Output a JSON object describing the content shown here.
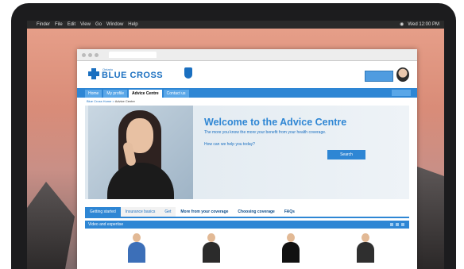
{
  "mac_menu": {
    "items": [
      "Finder",
      "File",
      "Edit",
      "View",
      "Go",
      "Window",
      "Help"
    ],
    "clock": "Wed 12:00 PM"
  },
  "site": {
    "logo_small": "Ontario",
    "logo_text": "BLUE CROSS",
    "nav": [
      "Home",
      "My profile",
      "Advice Centre",
      "Contact us"
    ]
  },
  "breadcrumb": {
    "parent": "Blue Cross Home",
    "current": "Advice Centre"
  },
  "hero": {
    "title": "Welcome to the Advice Centre",
    "subtext": "The more you know the more your benefit from your health coverage.",
    "question": "How can we help you today?",
    "search_button": "Search"
  },
  "content_tabs": [
    "Getting started",
    "Insurance basics",
    "Get",
    "More from your coverage",
    "Choosing coverage",
    "FAQs"
  ],
  "panel": {
    "title": "Video and expertise"
  },
  "people": [
    {
      "shirt": "#3c6fb8"
    },
    {
      "shirt": "#2b2b2b"
    },
    {
      "shirt": "#111111"
    },
    {
      "shirt": "#2f2f2f"
    }
  ],
  "colors": {
    "brand_blue": "#1a6fc0",
    "nav_blue": "#2e86d4"
  }
}
